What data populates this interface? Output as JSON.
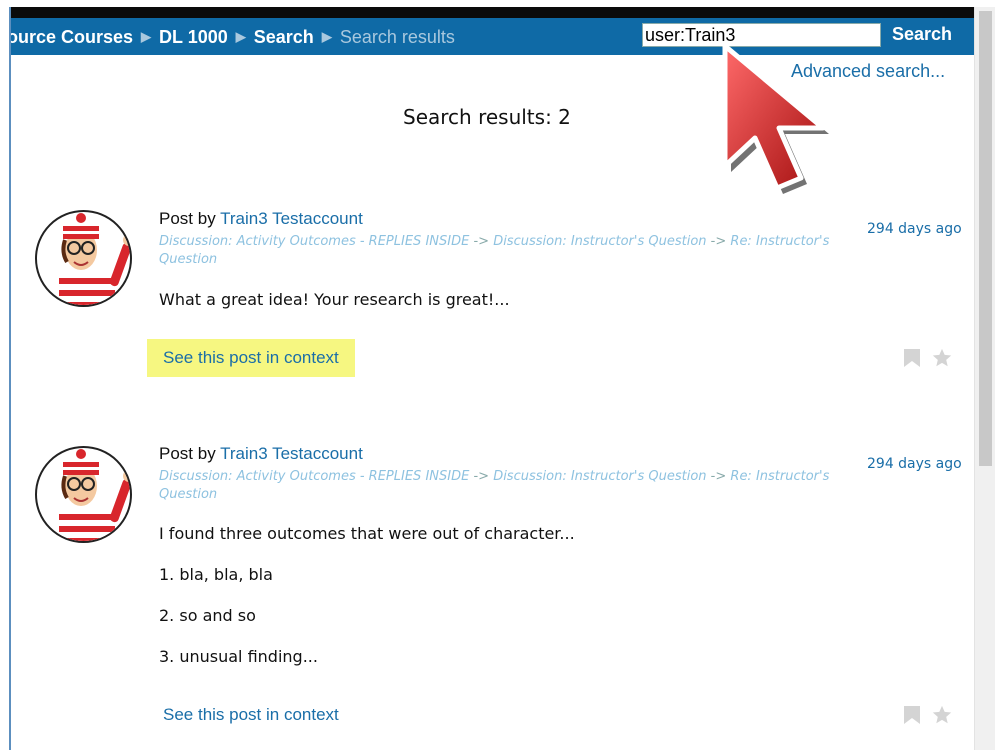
{
  "breadcrumb": {
    "items": [
      "ource Courses",
      "DL 1000",
      "Search",
      "Search results"
    ]
  },
  "search": {
    "value": "user:Train3",
    "button_label": "Search",
    "advanced_label": "Advanced search..."
  },
  "results_title": "Search results: 2",
  "posts": [
    {
      "by_prefix": "Post by ",
      "author": "Train3 Testaccount",
      "trail": [
        "Discussion: Activity Outcomes - REPLIES INSIDE",
        "Discussion: Instructor's Question",
        "Re: Instructor's Question"
      ],
      "trail_sep": "->",
      "age": "294 days ago",
      "body": [
        "What a great idea! Your research is great!..."
      ],
      "context_link": "See this post in context"
    },
    {
      "by_prefix": "Post by ",
      "author": "Train3 Testaccount",
      "trail": [
        "Discussion: Activity Outcomes - REPLIES INSIDE",
        "Discussion: Instructor's Question",
        "Re: Instructor's Question"
      ],
      "trail_sep": "->",
      "age": "294 days ago",
      "body": [
        "I found three outcomes that were out of character...",
        "1. bla, bla, bla",
        "2. so and so",
        "3. unusual finding..."
      ],
      "context_link": "See this post in context"
    }
  ],
  "icons": {
    "bookmark": "bookmark-icon",
    "star": "star-icon",
    "cursor": "mouse-pointer-icon"
  },
  "colors": {
    "navbar": "#0f6aa6",
    "link": "#1a6ea8",
    "highlight": "#f6f781",
    "cursor": "#c81e1e"
  }
}
